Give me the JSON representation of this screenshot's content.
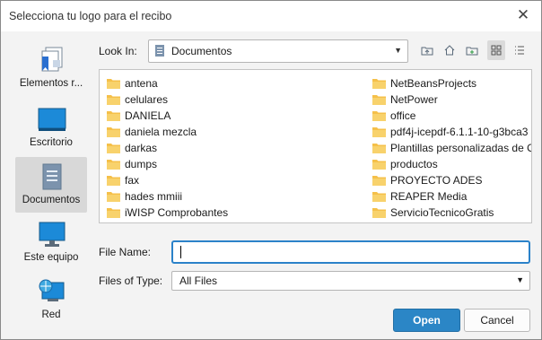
{
  "window": {
    "title": "Selecciona tu logo para el recibo"
  },
  "places": [
    {
      "label": "Elementos r...",
      "icon": "recent-items-icon",
      "selected": false
    },
    {
      "label": "Escritorio",
      "icon": "desktop-icon",
      "selected": false
    },
    {
      "label": "Documentos",
      "icon": "documents-icon",
      "selected": true
    },
    {
      "label": "Este equipo",
      "icon": "computer-icon",
      "selected": false
    },
    {
      "label": "Red",
      "icon": "network-icon",
      "selected": false
    }
  ],
  "lookin": {
    "label": "Look In:",
    "value": "Documentos"
  },
  "files_left": [
    "antena",
    "celulares",
    "DANIELA",
    "daniela mezcla",
    "darkas",
    "dumps",
    "fax",
    "hades mmiii",
    "iWISP Comprobantes"
  ],
  "files_right": [
    "NetBeansProjects",
    "NetPower",
    "office",
    "pdf4j-icepdf-6.1.1-10-g3bca3",
    "Plantillas personalizadas de O",
    "productos",
    "PROYECTO ADES",
    "REAPER Media",
    "ServicioTecnicoGratis"
  ],
  "filename": {
    "label": "File Name:",
    "value": ""
  },
  "filetype": {
    "label": "Files of Type:",
    "value": "All Files"
  },
  "buttons": {
    "open": "Open",
    "cancel": "Cancel"
  },
  "colors": {
    "accent": "#2b86c6",
    "folder": "#f5c04a"
  }
}
